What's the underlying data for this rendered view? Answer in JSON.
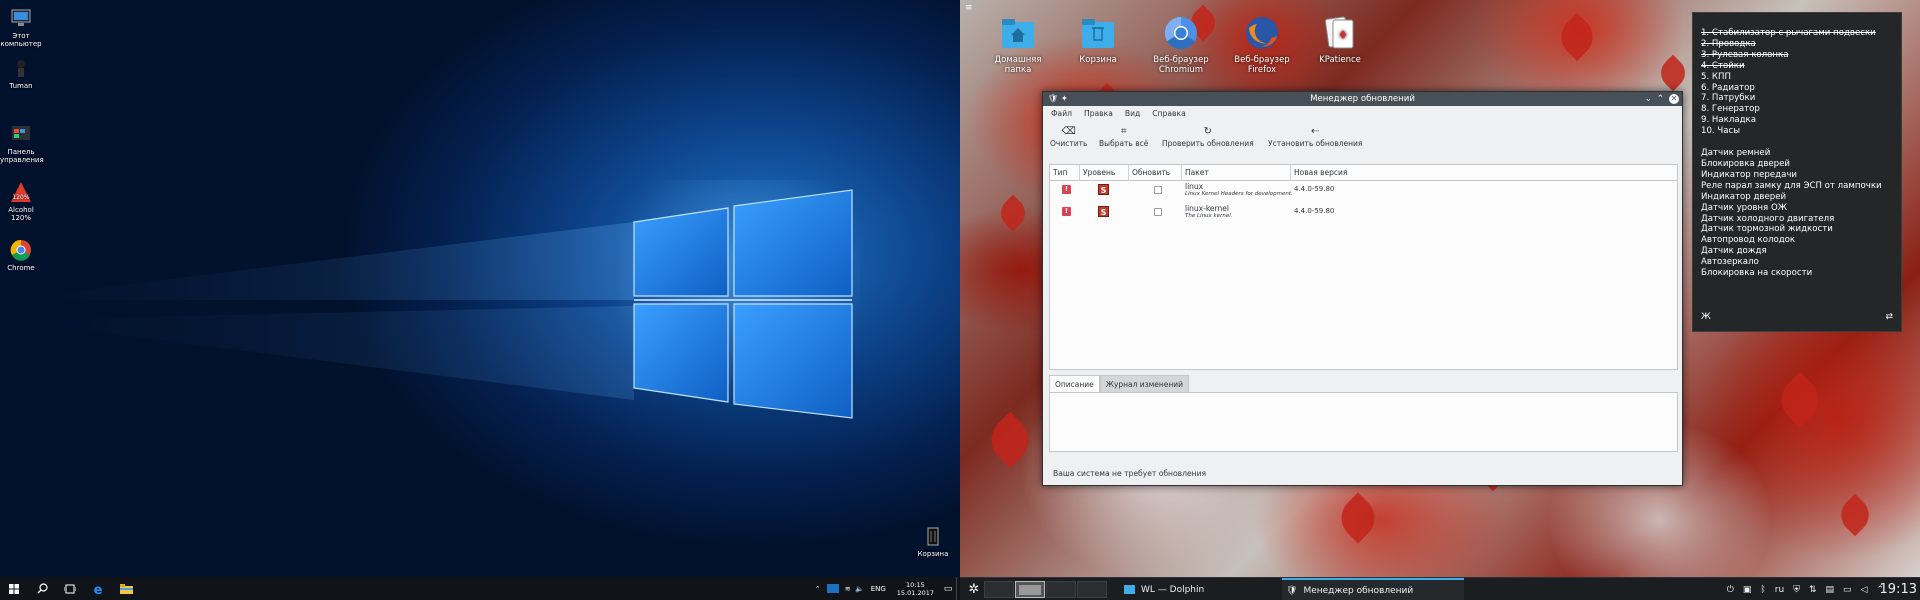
{
  "windows_desktop": {
    "icons": [
      {
        "label": "Этот компьютер",
        "icon": "computer-icon"
      },
      {
        "label": "Tuman",
        "icon": "tuman-app-icon"
      },
      {
        "label": "Панель управления",
        "icon": "control-panel-icon"
      },
      {
        "label": "Alcohol 120%",
        "icon": "alcohol-120-icon"
      },
      {
        "label": "Chrome",
        "icon": "chrome-icon"
      },
      {
        "label": "Корзина",
        "icon": "recycle-bin-icon"
      }
    ],
    "taskbar": {
      "language": "ENG",
      "time": "10:15",
      "date": "15.01.2017"
    },
    "colors": {
      "desktop": "#0c3f84",
      "taskbar": "#101418"
    }
  },
  "kde_desktop": {
    "icons": [
      {
        "label": "Домашняя папка",
        "icon": "home-folder-icon"
      },
      {
        "label": "Корзина",
        "icon": "trash-folder-icon"
      },
      {
        "label": "Веб-браузер Chromium",
        "icon": "chromium-icon"
      },
      {
        "label": "Веб-браузер Firefox",
        "icon": "firefox-icon"
      },
      {
        "label": "KPatience",
        "icon": "kpatience-icon"
      }
    ],
    "notes": {
      "done": [
        "1. Стабилизатор с рычагами подвески",
        "2. Проводка",
        "3. Рулевая колонка",
        "4. Стойки"
      ],
      "todo": [
        "5. КПП",
        "6. Радиатор",
        "7. Патрубки",
        "8. Генератор",
        "9. Накладка",
        "10. Часы"
      ],
      "items": [
        "Датчик ремней",
        "Блокировка дверей",
        "Индикатор передачи",
        "Реле парал замку для ЭСП от лампочки",
        "Индикатор дверей",
        "Датчик уровня ОЖ",
        "Датчик холодного двигателя",
        "Датчик тормозной жидкости",
        "Автопровод колодок",
        "Датчик дождя",
        "Автозеркало",
        "Блокировка на скорости"
      ]
    },
    "update_manager": {
      "title": "Менеджер обновлений",
      "menu": [
        "Файл",
        "Правка",
        "Вид",
        "Справка"
      ],
      "toolbar": [
        {
          "label": "Очистить",
          "icon": "clear-icon"
        },
        {
          "label": "Выбрать всё",
          "icon": "select-all-icon"
        },
        {
          "label": "Проверить обновления",
          "icon": "refresh-icon"
        },
        {
          "label": "Установить обновления",
          "icon": "install-arrow-icon"
        }
      ],
      "columns": [
        "Тип",
        "Уровень",
        "Обновить",
        "Пакет",
        "Новая версия"
      ],
      "rows": [
        {
          "type_icon": "warning-icon",
          "level": "S",
          "package": "linux",
          "description": "Linux Kernel Headers for development.",
          "version": "4.4.0-59.80"
        },
        {
          "type_icon": "warning-icon",
          "level": "S",
          "package": "linux-kernel",
          "description": "The Linux kernel.",
          "version": "4.4.0-59.80"
        }
      ],
      "tabs": [
        "Описание",
        "Журнал изменений"
      ],
      "status": "Ваша система не требует обновления"
    },
    "panel": {
      "tasks": [
        {
          "label": "WL — Dolphin",
          "icon": "dolphin-icon"
        },
        {
          "label": "Менеджер обновлений",
          "icon": "shield-icon"
        }
      ],
      "language": "ru",
      "time": "19:13"
    },
    "colors": {
      "panel": "#1b1e20",
      "titlebar": "#475057",
      "accent": "#3daee9",
      "window": "#eff0f1"
    }
  }
}
